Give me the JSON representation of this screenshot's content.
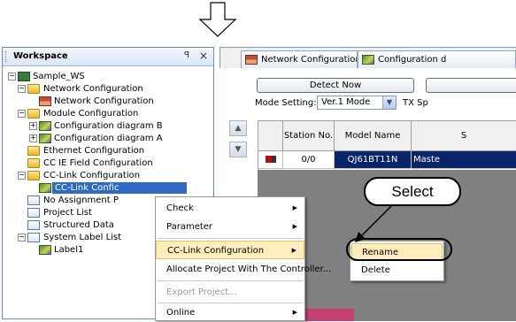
{
  "workspace": {
    "title": "Workspace",
    "pin_glyph": "p",
    "close_glyph": "×",
    "tree": [
      {
        "label": "Sample_WS",
        "icon": "workspace-icon"
      },
      {
        "label": "Network Configuration",
        "icon": "folder-icon"
      },
      {
        "label": "Network Configuration",
        "icon": "network-config-icon"
      },
      {
        "label": "Module Configuration",
        "icon": "folder-icon"
      },
      {
        "label": "Configuration diagram B",
        "icon": "config-diagram-icon"
      },
      {
        "label": "Configuration diagram A",
        "icon": "config-diagram-icon"
      },
      {
        "label": "Ethernet Configuration",
        "icon": "folder-icon"
      },
      {
        "label": "CC IE Field Configuration",
        "icon": "folder-icon"
      },
      {
        "label": "CC-Link Configuration",
        "icon": "folder-icon"
      },
      {
        "label": "CC-Link Confic",
        "icon": "cclink-icon"
      },
      {
        "label": "No Assignment P",
        "icon": "document-icon"
      },
      {
        "label": "Project List",
        "icon": "document-icon"
      },
      {
        "label": "Structured Data",
        "icon": "document-icon"
      },
      {
        "label": "System Label List",
        "icon": "system-label-icon"
      },
      {
        "label": "Label1",
        "icon": "label-icon"
      }
    ]
  },
  "tabs": [
    {
      "label": "Network Configuration"
    },
    {
      "label": "Configuration d"
    }
  ],
  "toolbar": {
    "detect_label": "Detect Now",
    "mode_label": "Mode Setting:",
    "mode_value": "Ver.1 Mode",
    "tx_label": "TX Sp"
  },
  "grid": {
    "headers": [
      "Station No.",
      "Model Name",
      "S"
    ],
    "row": {
      "station": "0/0",
      "model": "QJ61BT11N",
      "status": "Maste"
    }
  },
  "context_menu": {
    "items": [
      {
        "label": "Check",
        "submenu": true,
        "disabled": false
      },
      {
        "label": "Parameter",
        "submenu": true,
        "disabled": false
      },
      {
        "label": "CC-Link Configuration",
        "submenu": true,
        "disabled": false,
        "highlighted": true
      },
      {
        "label": "Allocate Project With The Controller...",
        "submenu": false,
        "disabled": false
      },
      {
        "label": "Export Project...",
        "submenu": false,
        "disabled": true
      },
      {
        "label": "Online",
        "submenu": true,
        "disabled": false
      }
    ]
  },
  "submenu": {
    "items": [
      {
        "label": "Rename",
        "highlighted": true
      },
      {
        "label": "Delete"
      }
    ]
  },
  "callout": {
    "text": "Select"
  },
  "colors": {
    "accent": "#316ac5",
    "menu_highlight": "#ffeebd",
    "panel_border": "#6b8cc1"
  }
}
